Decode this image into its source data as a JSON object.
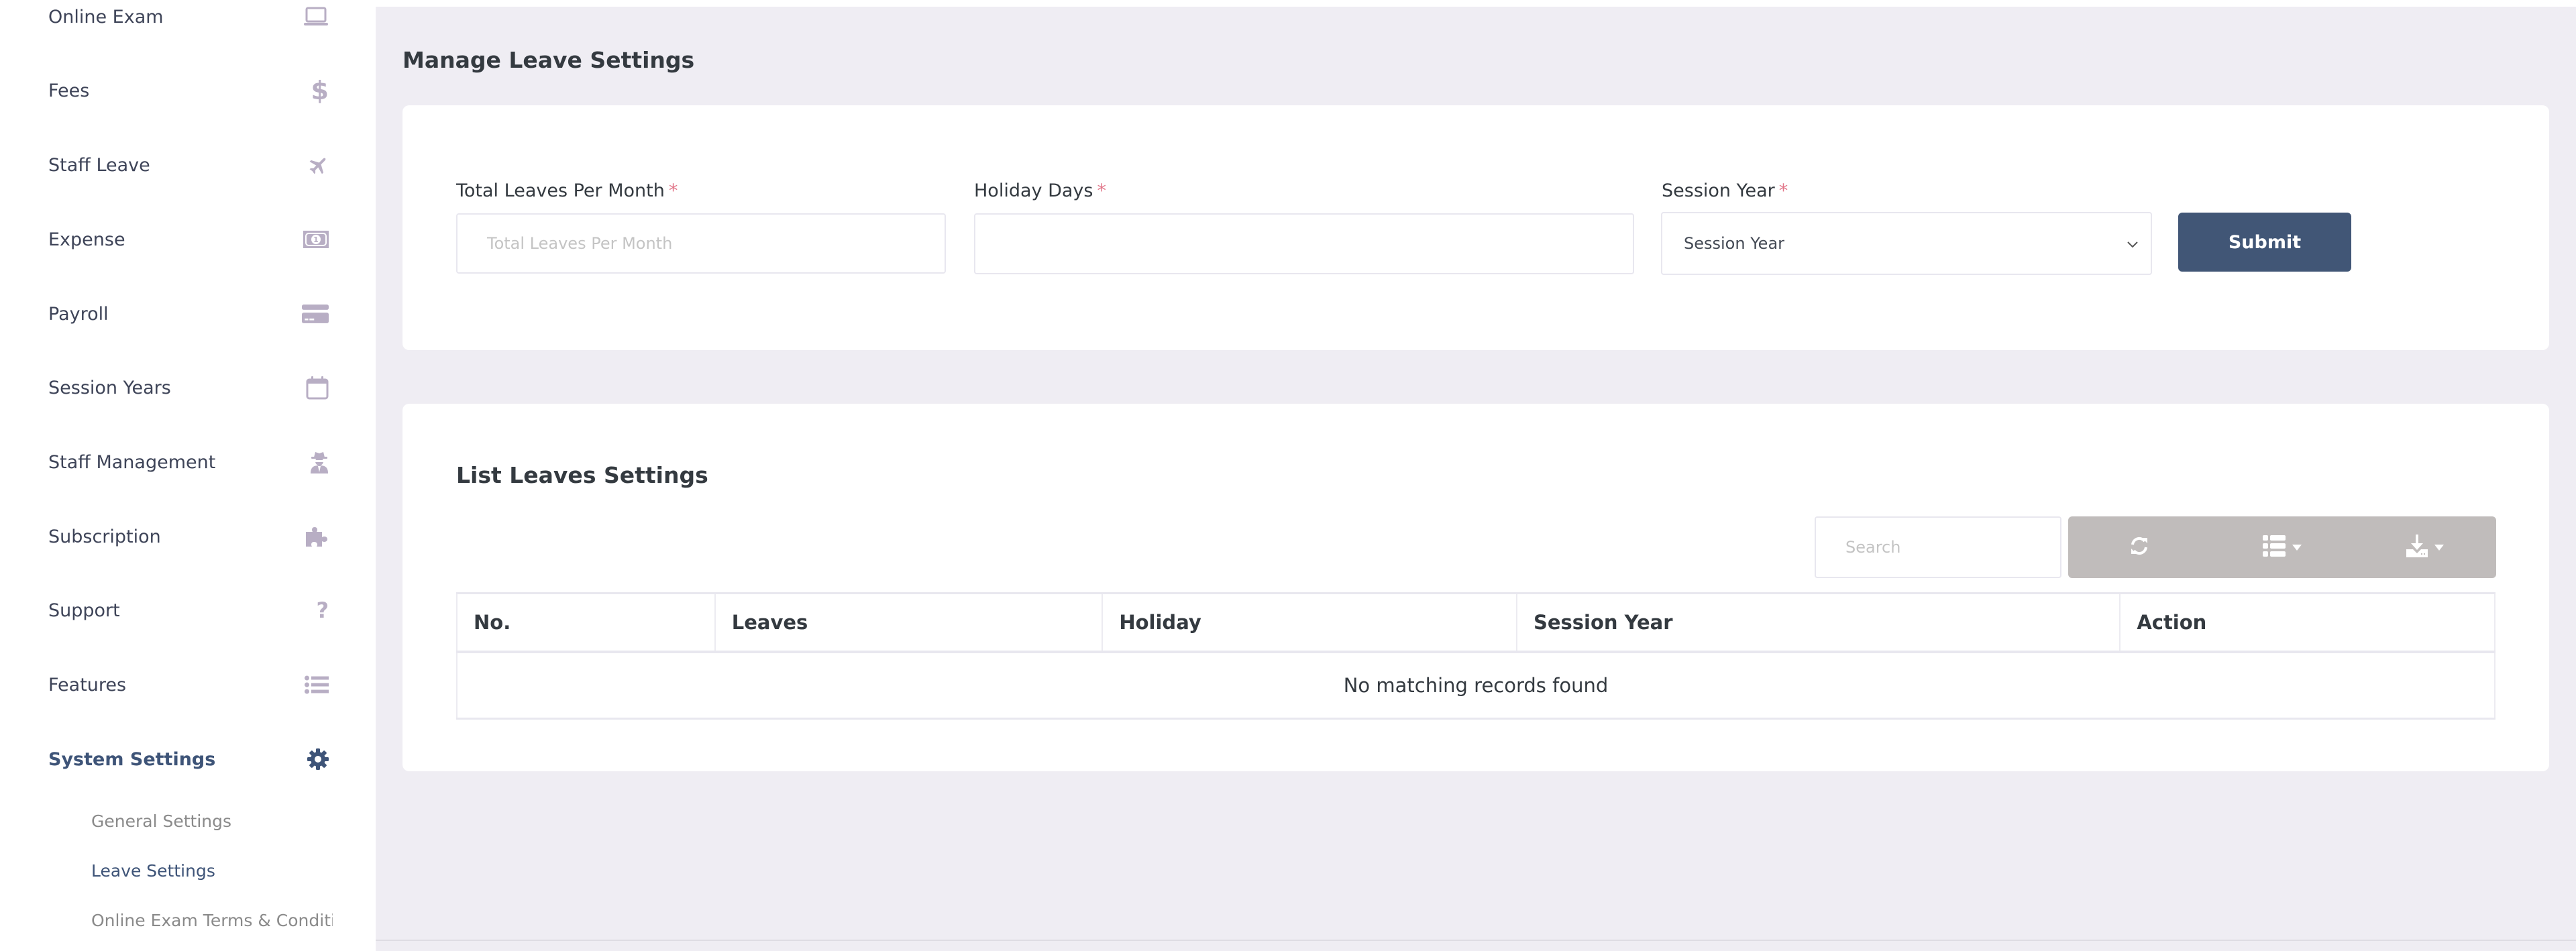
{
  "sidebar": {
    "items": [
      {
        "label": "Online Exam",
        "icon": "laptop-icon"
      },
      {
        "label": "Fees",
        "icon": "dollar-icon"
      },
      {
        "label": "Staff Leave",
        "icon": "plane-icon"
      },
      {
        "label": "Expense",
        "icon": "money-bill-icon"
      },
      {
        "label": "Payroll",
        "icon": "credit-card-icon"
      },
      {
        "label": "Session Years",
        "icon": "calendar-icon"
      },
      {
        "label": "Staff Management",
        "icon": "user-secret-icon"
      },
      {
        "label": "Subscription",
        "icon": "puzzle-icon"
      },
      {
        "label": "Support",
        "icon": "question-icon"
      },
      {
        "label": "Features",
        "icon": "list-icon"
      },
      {
        "label": "System Settings",
        "icon": "gear-icon",
        "active": true
      }
    ],
    "subitems": [
      {
        "label": "General Settings"
      },
      {
        "label": "Leave Settings",
        "active": true
      },
      {
        "label": "Online Exam Terms & Conditic"
      }
    ]
  },
  "page": {
    "title": "Manage Leave Settings"
  },
  "form": {
    "total_leaves": {
      "label": "Total Leaves Per Month",
      "required": "*",
      "placeholder": "Total Leaves Per Month",
      "value": ""
    },
    "holiday_days": {
      "label": "Holiday Days",
      "required": "*",
      "value": ""
    },
    "session_year": {
      "label": "Session Year",
      "required": "*",
      "selected": "Session Year"
    },
    "submit_label": "Submit"
  },
  "list": {
    "title": "List Leaves Settings",
    "search_placeholder": "Search",
    "toolbar": {
      "refresh_icon": "refresh-icon",
      "columns_icon": "columns-list-icon",
      "export_icon": "download-icon"
    },
    "columns": [
      "No.",
      "Leaves",
      "Holiday",
      "Session Year",
      "Action"
    ],
    "empty_message": "No matching records found"
  },
  "colors": {
    "primary": "#415676",
    "sidebar_icon": "#b8aec4",
    "required": "#e2778a",
    "background": "#efedf3",
    "toolbar": "#c0bcbb"
  }
}
